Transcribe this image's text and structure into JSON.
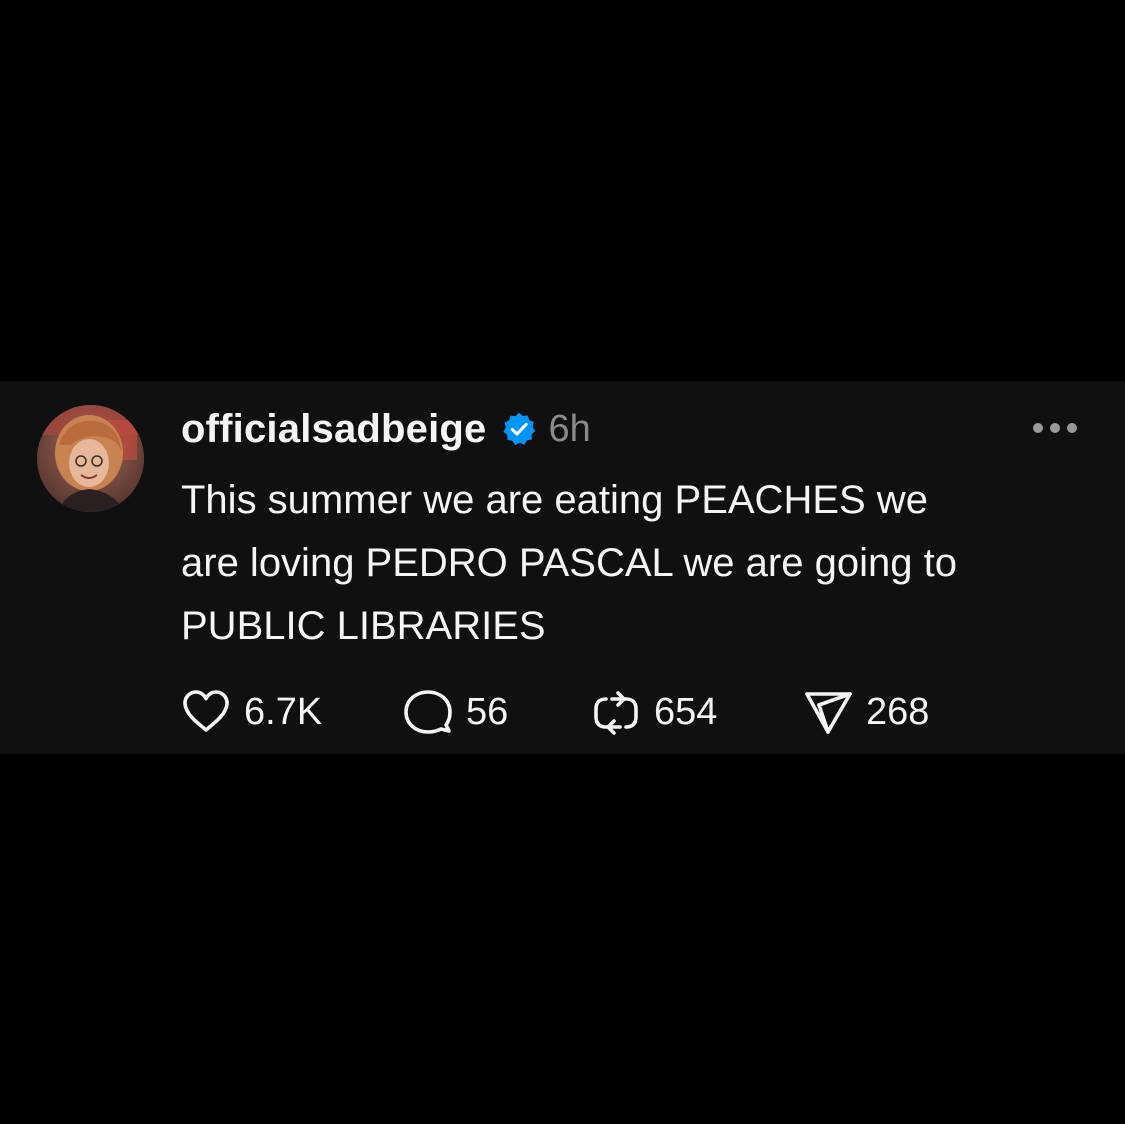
{
  "post": {
    "username": "officialsadbeige",
    "verified": true,
    "timestamp": "6h",
    "text": "This summer we are eating PEACHES we are loving PEDRO PASCAL we are going to PUBLIC LIBRARIES",
    "text_lines": [
      "This summer we are eating PEACHES we",
      "are loving PEDRO PASCAL we are going to",
      "PUBLIC LIBRARIES"
    ],
    "stats": {
      "likes": "6.7K",
      "replies": "56",
      "reposts": "654",
      "shares": "268"
    }
  },
  "icons": {
    "more": "more-horizontal-icon",
    "verified": "verified-badge-icon",
    "like": "heart-icon",
    "reply": "comment-bubble-icon",
    "repost": "repost-icon",
    "share": "send-icon"
  },
  "colors": {
    "background": "#000000",
    "card": "#101010",
    "text": "#f3f5f7",
    "muted": "#8a8a8a",
    "verified": "#0095f6"
  }
}
